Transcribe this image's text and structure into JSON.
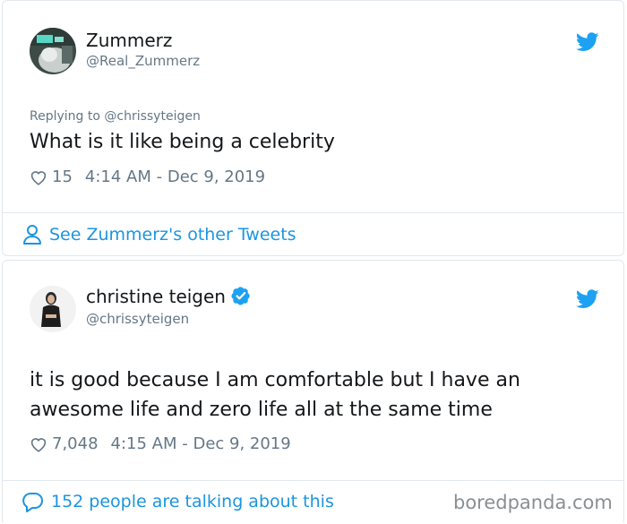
{
  "tweet1": {
    "author_name": "Zummerz",
    "author_handle": "@Real_Zummerz",
    "replying_to": "Replying to @chrissyteigen",
    "text": "What is it like being a celebrity",
    "likes": "15",
    "timestamp": "4:14 AM - Dec 9, 2019",
    "footer_link": "See Zummerz's other Tweets"
  },
  "tweet2": {
    "author_name": "christine teigen",
    "author_handle": "@chrissyteigen",
    "text_line1": "it is good because I am comfortable but I have an",
    "text_line2": "awesome life and zero life all at the same time",
    "likes": "7,048",
    "timestamp": "4:15 AM - Dec 9, 2019",
    "footer_link": "152 people are talking about this"
  },
  "watermark": "boredpanda.com",
  "colors": {
    "twitter_blue": "#1da1f2",
    "link_blue": "#1b95e0",
    "muted_gray": "#657786",
    "border": "#e1e8ed"
  },
  "icons": {
    "twitter": "twitter-bird-icon",
    "heart": "heart-icon",
    "person": "person-icon",
    "comment": "comment-bubble-icon",
    "verified": "verified-badge-icon"
  }
}
